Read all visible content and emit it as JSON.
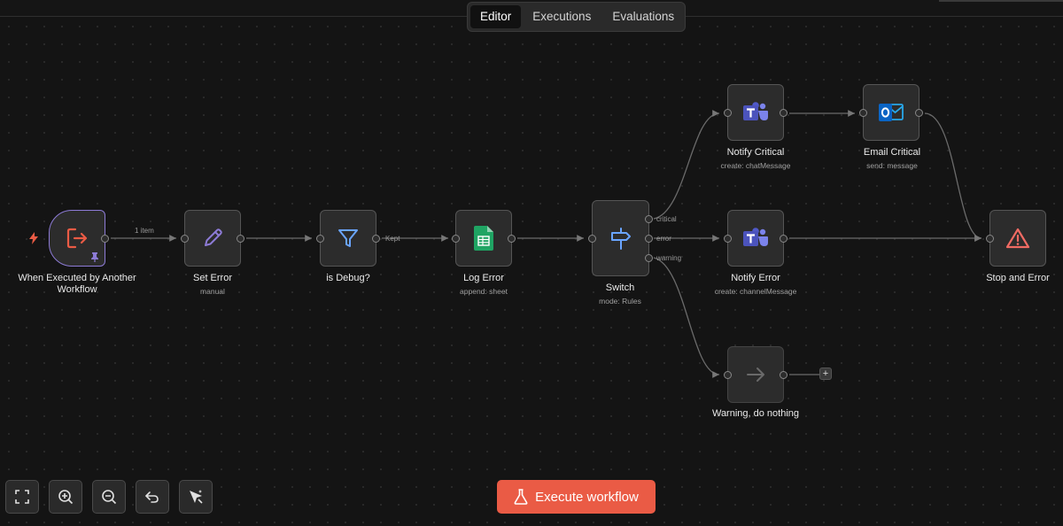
{
  "tabs": [
    {
      "label": "Editor",
      "active": true
    },
    {
      "label": "Executions",
      "active": false
    },
    {
      "label": "Evaluations",
      "active": false
    }
  ],
  "nodes": {
    "trigger": {
      "title": "When Executed by Another Workflow",
      "icon": "exit-arrow-icon"
    },
    "set_error": {
      "title": "Set Error",
      "subtitle": "manual",
      "icon": "pencil-icon"
    },
    "is_debug": {
      "title": "is Debug?",
      "icon": "filter-icon"
    },
    "log_error": {
      "title": "Log Error",
      "subtitle": "append: sheet",
      "icon": "google-sheets-icon"
    },
    "switch": {
      "title": "Switch",
      "subtitle": "mode: Rules",
      "icon": "signpost-icon"
    },
    "notify_critical": {
      "title": "Notify Critical",
      "subtitle": "create: chatMessage",
      "icon": "teams-icon"
    },
    "email_critical": {
      "title": "Email Critical",
      "subtitle": "send: message",
      "icon": "outlook-icon"
    },
    "notify_error": {
      "title": "Notify Error",
      "subtitle": "create: channelMessage",
      "icon": "teams-icon"
    },
    "warning": {
      "title": "Warning, do nothing",
      "icon": "arrow-right-icon"
    },
    "stop_error": {
      "title": "Stop and Error",
      "icon": "warning-triangle-icon"
    }
  },
  "edge_labels": {
    "items": "1 item",
    "kept": "Kept",
    "critical": "critical",
    "error": "error",
    "warning": "warning"
  },
  "add_button": "+",
  "execute_button": "Execute workflow",
  "controls": [
    "fit-view-icon",
    "zoom-in-icon",
    "zoom-out-icon",
    "undo-icon",
    "tidy-up-icon"
  ],
  "colors": {
    "accent": "#ea5b45",
    "trigger_border": "#8d7bd6",
    "filter_blue": "#6aa5ff",
    "sheets_green": "#1fa463",
    "teams_purple": "#5059c9",
    "outlook_blue": "#0a64c4",
    "stop_red": "#f06b63"
  }
}
